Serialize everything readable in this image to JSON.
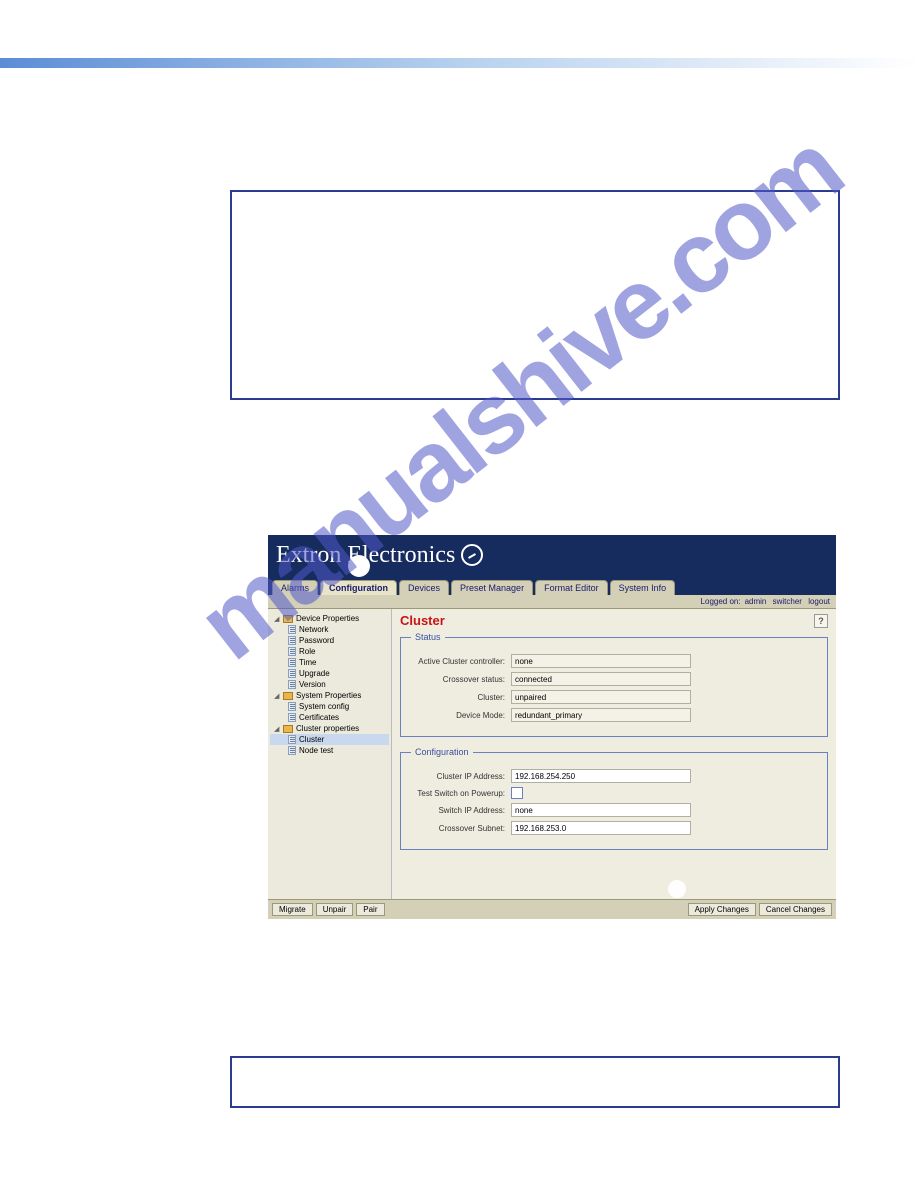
{
  "brand": {
    "text1": "Extron",
    "text2": "Electronics"
  },
  "tabs": [
    {
      "label": "Alarms",
      "active": false
    },
    {
      "label": "Configuration",
      "active": true
    },
    {
      "label": "Devices",
      "active": false
    },
    {
      "label": "Preset Manager",
      "active": false
    },
    {
      "label": "Format Editor",
      "active": false
    },
    {
      "label": "System Info",
      "active": false
    }
  ],
  "status_bar": {
    "logged_label": "Logged on:",
    "user": "admin",
    "links": [
      "switcher",
      "logout"
    ]
  },
  "sidebar": {
    "groups": [
      {
        "label": "Device Properties",
        "items": [
          "Network",
          "Password",
          "Role",
          "Time",
          "Upgrade",
          "Version"
        ],
        "selected": null
      },
      {
        "label": "System Properties",
        "items": [
          "System config",
          "Certificates"
        ],
        "selected": null
      },
      {
        "label": "Cluster properties",
        "items": [
          "Cluster",
          "Node test"
        ],
        "selected": "Cluster"
      }
    ]
  },
  "page": {
    "title": "Cluster",
    "help": "?"
  },
  "status_fieldset": {
    "legend": "Status",
    "rows": [
      {
        "label": "Active Cluster controller:",
        "value": "none"
      },
      {
        "label": "Crossover status:",
        "value": "connected"
      },
      {
        "label": "Cluster:",
        "value": "unpaired"
      },
      {
        "label": "Device Mode:",
        "value": "redundant_primary"
      }
    ]
  },
  "config_fieldset": {
    "legend": "Configuration",
    "rows": [
      {
        "label": "Cluster IP Address:",
        "value": "192.168.254.250",
        "type": "text"
      },
      {
        "label": "Test Switch on Powerup:",
        "value": "",
        "type": "checkbox"
      },
      {
        "label": "Switch IP Address:",
        "value": "none",
        "type": "text"
      },
      {
        "label": "Crossover Subnet:",
        "value": "192.168.253.0",
        "type": "text"
      }
    ]
  },
  "buttons": {
    "left": [
      "Migrate",
      "Unpair",
      "Pair"
    ],
    "right": [
      "Apply Changes",
      "Cancel Changes"
    ]
  },
  "watermark": "manualshive.com"
}
